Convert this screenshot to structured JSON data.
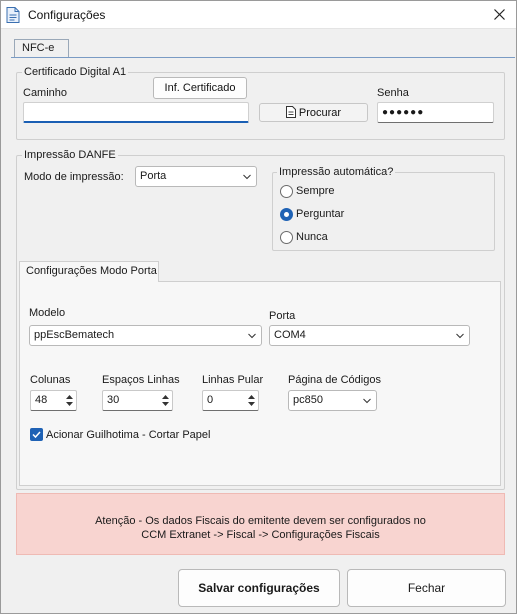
{
  "window": {
    "title": "Configurações"
  },
  "tabs": {
    "nfce": "NFC-e"
  },
  "certificado": {
    "group_title": "Certificado Digital A1",
    "info_button": "Inf. Certificado",
    "caminho_label": "Caminho",
    "caminho_value": "",
    "procurar_button": "Procurar",
    "senha_label": "Senha",
    "senha_value": "●●●●●●"
  },
  "impressao": {
    "group_title": "Impressão DANFE",
    "modo_label": "Modo de impressão:",
    "modo_value": "Porta",
    "auto_title": "Impressão automática?",
    "options": [
      {
        "label": "Sempre",
        "checked": false
      },
      {
        "label": "Perguntar",
        "checked": true
      },
      {
        "label": "Nunca",
        "checked": false
      }
    ]
  },
  "porta_config": {
    "tab_label": "Configurações Modo Porta",
    "modelo_label": "Modelo",
    "modelo_value": "ppEscBematech",
    "porta_label": "Porta",
    "porta_value": "COM4",
    "colunas_label": "Colunas",
    "colunas_value": "48",
    "espacos_label": "Espaços Linhas",
    "espacos_value": "30",
    "linhas_label": "Linhas Pular",
    "linhas_value": "0",
    "pagina_label": "Página de Códigos",
    "pagina_value": "pc850",
    "guilhotina_label": "Acionar Guilhotima - Cortar Papel",
    "guilhotina_checked": true
  },
  "banner": {
    "line1": "Atenção - Os dados Fiscais do emitente devem ser configurados no",
    "line2": "CCM Extranet -> Fiscal -> Configurações Fiscais"
  },
  "footer": {
    "save_label": "Salvar configurações",
    "close_label": "Fechar"
  },
  "colors": {
    "accent": "#1f62b5",
    "banner_bg": "#f8d4d0"
  }
}
